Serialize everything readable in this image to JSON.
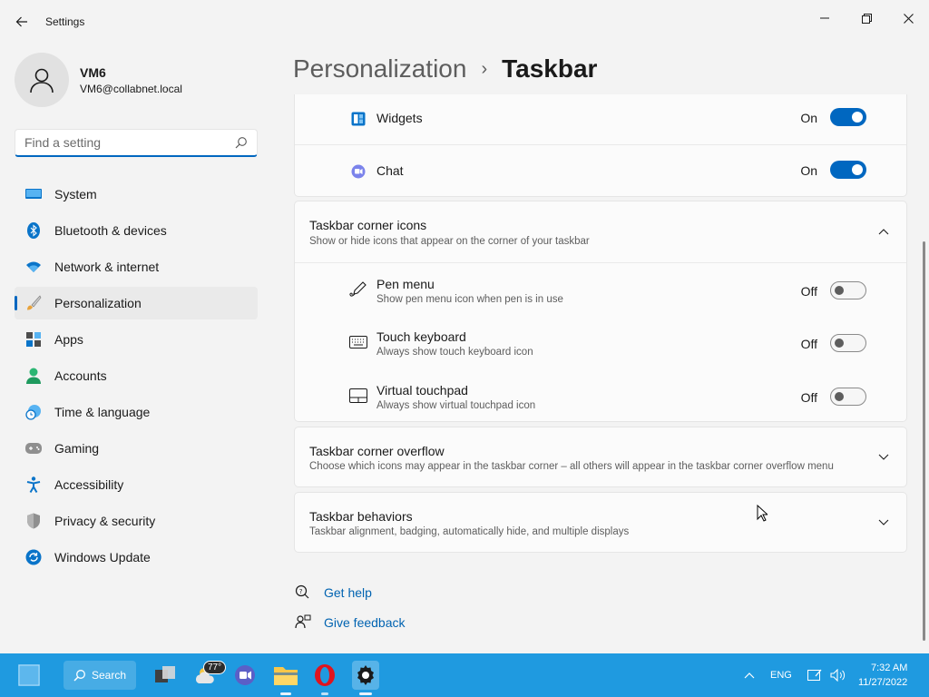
{
  "app": {
    "title": "Settings"
  },
  "profile": {
    "name": "VM6",
    "email": "VM6@collabnet.local"
  },
  "search": {
    "placeholder": "Find a setting"
  },
  "sidebar": {
    "items": [
      {
        "label": "System",
        "icon": "system-icon"
      },
      {
        "label": "Bluetooth & devices",
        "icon": "bluetooth-icon"
      },
      {
        "label": "Network & internet",
        "icon": "wifi-icon"
      },
      {
        "label": "Personalization",
        "icon": "brush-icon",
        "selected": true
      },
      {
        "label": "Apps",
        "icon": "apps-icon"
      },
      {
        "label": "Accounts",
        "icon": "accounts-icon"
      },
      {
        "label": "Time & language",
        "icon": "clock-globe-icon"
      },
      {
        "label": "Gaming",
        "icon": "gamepad-icon"
      },
      {
        "label": "Accessibility",
        "icon": "accessibility-icon"
      },
      {
        "label": "Privacy & security",
        "icon": "shield-icon"
      },
      {
        "label": "Windows Update",
        "icon": "update-icon"
      }
    ]
  },
  "breadcrumb": {
    "parent": "Personalization",
    "separator": "›",
    "current": "Taskbar"
  },
  "taskbar_items": {
    "widgets": {
      "label": "Widgets",
      "state": "On",
      "on": true,
      "icon": "widgets-icon"
    },
    "chat": {
      "label": "Chat",
      "state": "On",
      "on": true,
      "icon": "chat-icon"
    }
  },
  "corner_icons": {
    "title": "Taskbar corner icons",
    "description": "Show or hide icons that appear on the corner of your taskbar",
    "expanded": true,
    "items": [
      {
        "label": "Pen menu",
        "description": "Show pen menu icon when pen is in use",
        "state": "Off",
        "on": false,
        "icon": "pen-icon"
      },
      {
        "label": "Touch keyboard",
        "description": "Always show touch keyboard icon",
        "state": "Off",
        "on": false,
        "icon": "keyboard-icon"
      },
      {
        "label": "Virtual touchpad",
        "description": "Always show virtual touchpad icon",
        "state": "Off",
        "on": false,
        "icon": "touchpad-icon"
      }
    ]
  },
  "corner_overflow": {
    "title": "Taskbar corner overflow",
    "description": "Choose which icons may appear in the taskbar corner – all others will appear in the taskbar corner overflow menu"
  },
  "behaviors": {
    "title": "Taskbar behaviors",
    "description": "Taskbar alignment, badging, automatically hide, and multiple displays"
  },
  "help": {
    "get_help": "Get help",
    "give_feedback": "Give feedback"
  },
  "system_taskbar": {
    "search_label": "Search",
    "weather_badge": "77°",
    "language": "ENG",
    "time": "7:32 AM",
    "date": "11/27/2022"
  },
  "colors": {
    "accent": "#0067c0",
    "taskbar": "#1f9ae0",
    "link": "#0063b1"
  }
}
